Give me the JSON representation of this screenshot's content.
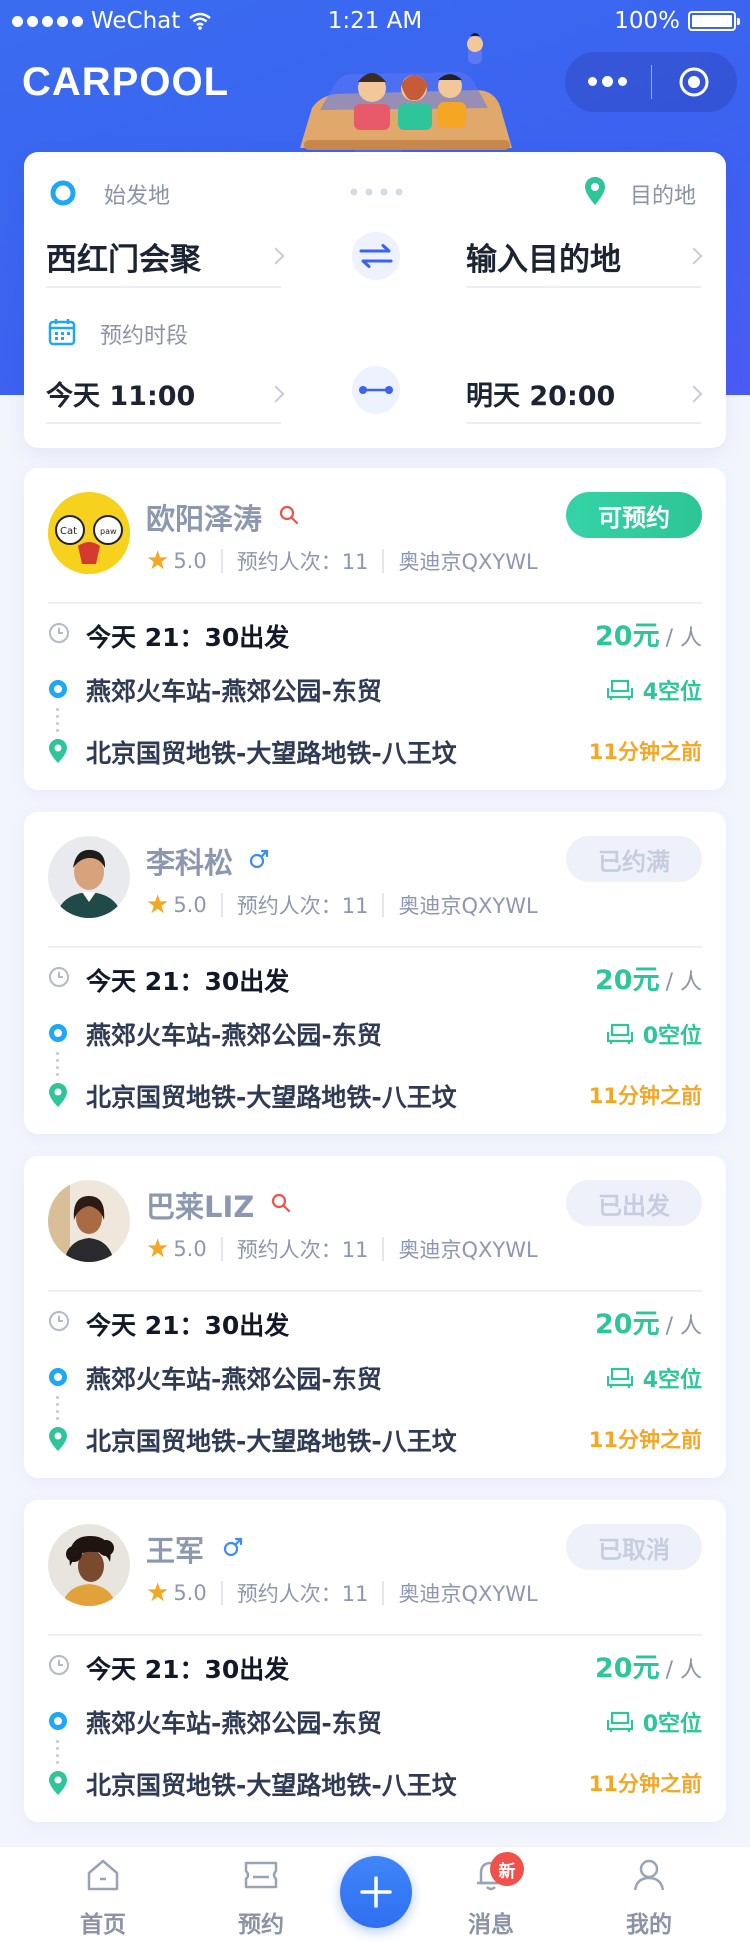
{
  "status_bar": {
    "carrier": "WeChat",
    "time": "1:21 AM",
    "battery": "100%"
  },
  "header": {
    "title": "CARPOOL"
  },
  "search": {
    "origin_label": "始发地",
    "origin_value": "西红门会聚",
    "destination_label": "目的地",
    "destination_value": "输入目的地",
    "period_label": "预约时段",
    "start_time": "今天 11:00",
    "end_time": "明天 20:00"
  },
  "rides": [
    {
      "name": "欧阳泽涛",
      "gender_icon": "search-icon-red",
      "rating": "5.0",
      "bookings": "预约人次：11",
      "plate": "奥迪京QXYWL",
      "status": "可预约",
      "status_state": "active",
      "depart": "今天 21：30出发",
      "price": "20元",
      "price_unit": "/ 人",
      "from": "燕郊火车站-燕郊公园-东贸",
      "to": "北京国贸地铁-大望路地铁-八王坟",
      "seats": "4空位",
      "posted": "11分钟之前"
    },
    {
      "name": "李科松",
      "gender_icon": "male-icon",
      "rating": "5.0",
      "bookings": "预约人次：11",
      "plate": "奥迪京QXYWL",
      "status": "已约满",
      "status_state": "off",
      "depart": "今天 21：30出发",
      "price": "20元",
      "price_unit": "/ 人",
      "from": "燕郊火车站-燕郊公园-东贸",
      "to": "北京国贸地铁-大望路地铁-八王坟",
      "seats": "0空位",
      "posted": "11分钟之前"
    },
    {
      "name": "巴莱LIZ",
      "gender_icon": "search-icon-red",
      "rating": "5.0",
      "bookings": "预约人次：11",
      "plate": "奥迪京QXYWL",
      "status": "已出发",
      "status_state": "off",
      "depart": "今天 21：30出发",
      "price": "20元",
      "price_unit": "/ 人",
      "from": "燕郊火车站-燕郊公园-东贸",
      "to": "北京国贸地铁-大望路地铁-八王坟",
      "seats": "4空位",
      "posted": "11分钟之前"
    },
    {
      "name": "王军",
      "gender_icon": "male-icon",
      "rating": "5.0",
      "bookings": "预约人次：11",
      "plate": "奥迪京QXYWL",
      "status": "已取消",
      "status_state": "off",
      "depart": "今天 21：30出发",
      "price": "20元",
      "price_unit": "/ 人",
      "from": "燕郊火车站-燕郊公园-东贸",
      "to": "北京国贸地铁-大望路地铁-八王坟",
      "seats": "0空位",
      "posted": "11分钟之前"
    }
  ],
  "tabbar": {
    "home": "首页",
    "booking": "预约",
    "messages": "消息",
    "messages_badge": "新",
    "mine": "我的"
  },
  "colors": {
    "primary": "#3b62f0",
    "accent_green": "#2fc59a",
    "warning": "#f5a623",
    "badge_red": "#f0524b"
  }
}
